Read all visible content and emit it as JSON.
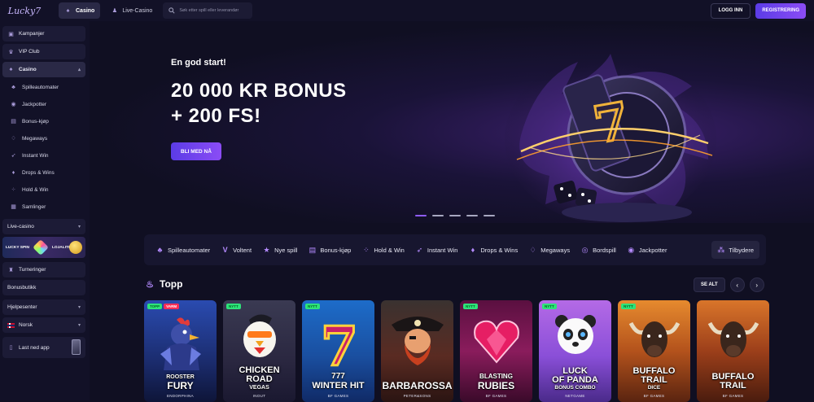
{
  "brand": {
    "logo_text": "Lucky7",
    "accent": "#7a4df0"
  },
  "topbar": {
    "casino_label": "Casino",
    "live_casino_label": "Live-Casino",
    "search_placeholder": "Søk etter spill eller leverandør",
    "login_label": "LOGG INN",
    "register_label": "REGISTRERING"
  },
  "sidebar": {
    "items_top": [
      "Kampanjer",
      "VIP Club"
    ],
    "casino_label": "Casino",
    "casino_sub": [
      "Spilleautomater",
      "Jackpotter",
      "Bonus-kjøp",
      "Megaways",
      "Instant Win",
      "Drops & Wins",
      "Hold & Win",
      "Samlinger"
    ],
    "live_casino_label": "Live-casino",
    "loyalty": {
      "left": "LUCKY SPIN",
      "right": "LOJALITETSP..."
    },
    "items_bottom": [
      "Turneringer",
      "Bonusbutikk"
    ],
    "help_label": "Hjelpesenter",
    "language_label": "Norsk",
    "app_label": "Last ned app"
  },
  "hero": {
    "kicker": "En god start!",
    "title_line1": "20 000 KR BONUS",
    "title_line2": "+ 200 FS!",
    "cta": "BLI MED NÅ",
    "slide_count": 5,
    "active_slide": 1
  },
  "categories": [
    "Spilleautomater",
    "Voltent",
    "Nye spill",
    "Bonus-kjøp",
    "Hold & Win",
    "Instant Win",
    "Drops & Wins",
    "Megaways",
    "Bordspill",
    "Jackpotter",
    "Tilbydere"
  ],
  "top_section": {
    "title": "Topp",
    "see_all": "SE ALT",
    "games": [
      {
        "name1": "ROOSTER",
        "name2": "FURY",
        "provider": "ENDORPHINA",
        "badges": [
          "TOPP",
          "VARM"
        ]
      },
      {
        "name1": "CHICKEN",
        "name2": "ROAD",
        "name3": "VEGAS",
        "provider": "INOUT",
        "badges": [
          "NYTT"
        ]
      },
      {
        "name1": "777",
        "name2": "WINTER HIT",
        "provider": "BF GAMES",
        "badges": [
          "NYTT"
        ]
      },
      {
        "name1": "BARBAROSSA",
        "provider": "PETER&SONS",
        "badges": []
      },
      {
        "name1": "BLASTING",
        "name2": "RUBIES",
        "provider": "BF GAMES",
        "badges": [
          "NYTT"
        ]
      },
      {
        "name1": "LUCK",
        "name2": "OF PANDA",
        "name3": "BONUS COMBO",
        "provider": "NETGAME",
        "badges": [
          "NYTT"
        ]
      },
      {
        "name1": "BUFFALO",
        "name2": "TRAIL",
        "name3": "DICE",
        "provider": "BF GAMES",
        "badges": [
          "NYTT"
        ]
      },
      {
        "name1": "BUFFALO",
        "name2": "TRAIL",
        "provider": "BF GAMES",
        "badges": []
      }
    ]
  }
}
